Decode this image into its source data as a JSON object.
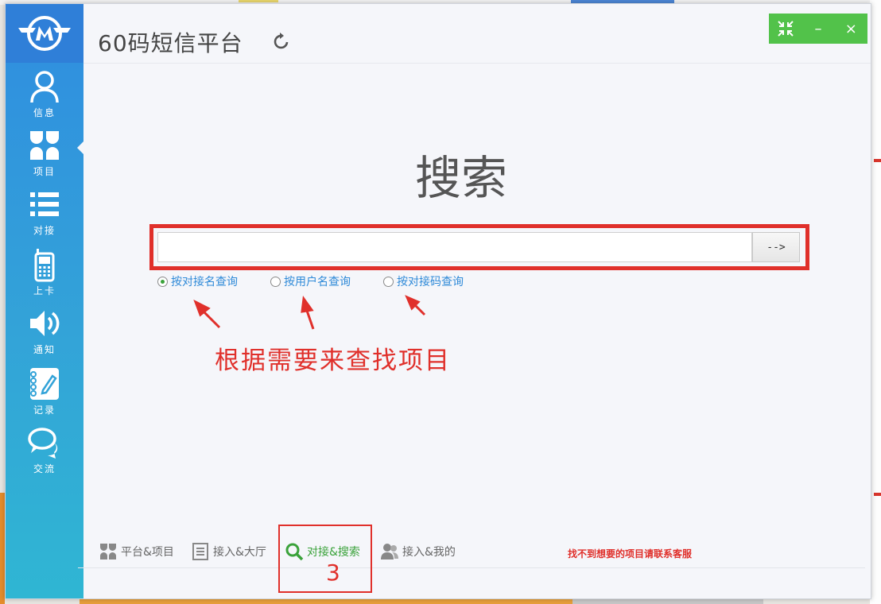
{
  "app": {
    "title": "60码短信平台"
  },
  "window_controls": {
    "restore_icon": "compress-arrows-icon",
    "minimize_label": "–",
    "close_label": "×"
  },
  "sidebar": {
    "items": [
      {
        "label": "信息",
        "icon": "user-icon"
      },
      {
        "label": "项目",
        "icon": "clover-grid-icon"
      },
      {
        "label": "对接",
        "icon": "list-icon"
      },
      {
        "label": "上卡",
        "icon": "phone-icon"
      },
      {
        "label": "通知",
        "icon": "speaker-icon"
      },
      {
        "label": "记录",
        "icon": "notebook-pen-icon"
      },
      {
        "label": "交流",
        "icon": "chat-bubbles-icon"
      }
    ],
    "active_index": 1
  },
  "search": {
    "heading": "搜索",
    "input_value": "",
    "go_label": "-->",
    "options": [
      {
        "label": "按对接名查询",
        "checked": true
      },
      {
        "label": "按用户名查询",
        "checked": false
      },
      {
        "label": "按对接码查询",
        "checked": false
      }
    ]
  },
  "annotation": {
    "text": "根据需要来查找项目",
    "tab_number": "3"
  },
  "bottom_tabs": [
    {
      "label": "平台&项目",
      "icon": "clover-grid-icon",
      "active": false
    },
    {
      "label": "接入&大厅",
      "icon": "document-list-icon",
      "active": false
    },
    {
      "label": "对接&搜索",
      "icon": "search-icon",
      "active": true
    },
    {
      "label": "接入&我的",
      "icon": "users-icon",
      "active": false
    }
  ],
  "contact_note": "找不到想要的项目请联系客服",
  "colors": {
    "accent_green": "#52c24a",
    "sidebar_blue": "#2f8de0",
    "annotation_red": "#e0302b",
    "link_blue": "#2f8ad8"
  }
}
